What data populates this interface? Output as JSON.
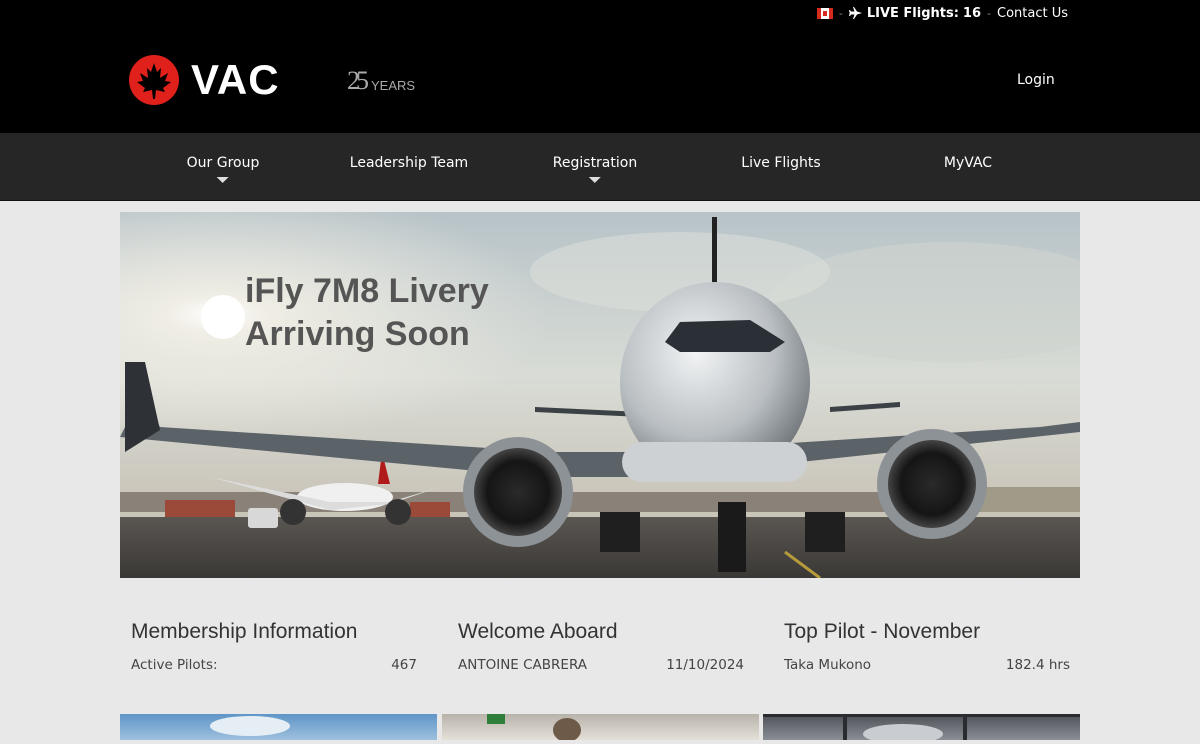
{
  "topbar": {
    "separator": "-",
    "live_label": "LIVE Flights:",
    "live_count": "16",
    "contact_label": "Contact Us"
  },
  "brand": {
    "logo_text": "VAC",
    "years_number": "25",
    "years_word": "YEARS"
  },
  "header": {
    "login_label": "Login"
  },
  "nav": {
    "items": [
      {
        "label": "Our Group",
        "dropdown": true
      },
      {
        "label": "Leadership Team",
        "dropdown": false
      },
      {
        "label": "Registration",
        "dropdown": true
      },
      {
        "label": "Live Flights",
        "dropdown": false
      },
      {
        "label": "MyVAC",
        "dropdown": false
      }
    ]
  },
  "hero": {
    "title_line1": "iFly 7M8 Livery",
    "title_line2": "Arriving Soon"
  },
  "membership": {
    "heading": "Membership Information",
    "label": "Active Pilots:",
    "value": "467"
  },
  "welcome": {
    "heading": "Welcome Aboard",
    "name": "ANTOINE CABRERA",
    "date": "11/10/2024"
  },
  "top_pilot": {
    "heading": "Top Pilot - November",
    "name": "Taka Mukono",
    "hours": "182.4 hrs"
  },
  "colors": {
    "header_bg": "#000000",
    "nav_bg": "#262626",
    "page_bg": "#e8e8e8",
    "brand_red": "#e0201b"
  },
  "icons": [
    "canada-flag-icon",
    "airplane-icon",
    "maple-leaf-icon",
    "dropdown-caret-icon"
  ]
}
